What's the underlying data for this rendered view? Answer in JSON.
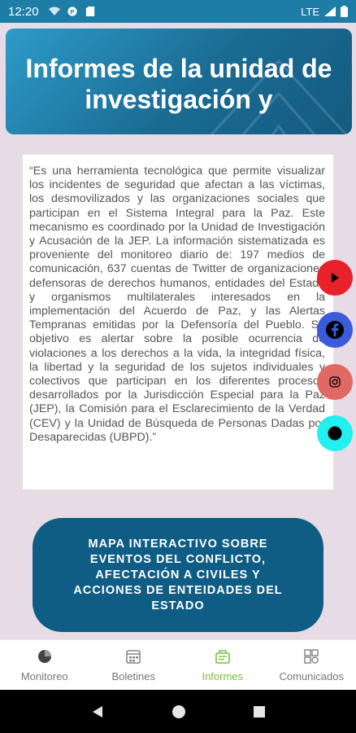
{
  "status_bar": {
    "time": "12:20",
    "network": "LTE"
  },
  "header": {
    "title": "Informes de la unidad de investigación y"
  },
  "description": "“Es una herramienta tecnológica que permite visualizar los incidentes de seguridad que afectan a las víctimas, los desmovilizados y las organizaciones sociales que participan en el Sistema Integral para la Paz. Este mecanismo es coordinado por la Unidad de Investigación y Acusación de la JEP. La información sistematizada es proveniente del monitoreo diario de: 197 medios de comunicación, 637 cuentas de Twitter de organizaciones defensoras de derechos humanos, entidades del Estado y organismos multilaterales interesados en la implementación del Acuerdo de Paz, y las Alertas Tempranas emitidas por la Defensoría del Pueblo. Su objetivo es alertar sobre la posible ocurrencia de violaciones a los derechos a la vida, la integridad física, la libertad y la seguridad de los sujetos individuales y colectivos que participan en los diferentes procesos desarrollados por la Jurisdicción Especial para la Paz (JEP), la Comisión para el Esclarecimiento de la Verdad (CEV) y la Unidad de Búsqueda de Personas Dadas por Desaparecidas (UBPD).”",
  "map_button": {
    "label": "MAPA INTERACTIVO SOBRE\nEVENTOS DEL CONFLICTO,\nAFECTACIÓN A CIVILES Y\nACCIONES DE ENTEIDADES DEL\nESTADO"
  },
  "social": [
    {
      "icon": "youtube-icon",
      "color": "#e8222a"
    },
    {
      "icon": "facebook-icon",
      "color": "#3b5bdb"
    },
    {
      "icon": "instagram-icon",
      "color": "#e06a63"
    },
    {
      "icon": "dot-icon",
      "color": "#22f0ee"
    }
  ],
  "bottom_nav": [
    {
      "label": "Monitoreo",
      "icon": "pie-chart-icon",
      "active": false
    },
    {
      "label": "Boletines",
      "icon": "calendar-icon",
      "active": false
    },
    {
      "label": "Informes",
      "icon": "report-icon",
      "active": true
    },
    {
      "label": "Comunicados",
      "icon": "grid-icon",
      "active": false
    }
  ],
  "colors": {
    "primary": "#1d7da6",
    "button": "#0f5d85",
    "active_nav": "#7bbd3f",
    "background": "#e7dce6"
  }
}
